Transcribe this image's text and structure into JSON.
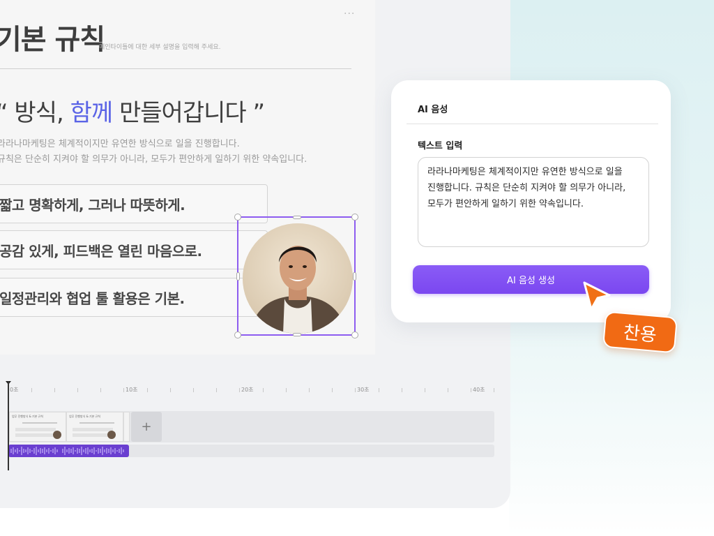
{
  "slide": {
    "more_icon": "···",
    "title": "기본 규칙",
    "title_desc": "메인타이틀에 대한 세부 설명을 입력해 주세요.",
    "quote_prefix": "“ 방식,",
    "quote_accent": " 함께",
    "quote_suffix": " 만들어갑니다 ”",
    "desc_line1": "라라나마케팅은 체계적이지만 유연한 방식으로 일을 진행합니다.",
    "desc_line2": "규칙은 단순히 지켜야 할 의무가 아니라, 모두가 편안하게 일하기 위한 약속입니다.",
    "rules": [
      "짧고 명확하게, 그러나 따뜻하게.",
      "공감 있게, 피드백은 열린 마음으로.",
      "일정관리와 협업 툴 활용은 기본."
    ]
  },
  "timeline": {
    "ruler_labels": [
      "0초",
      "10초",
      "20초",
      "30초",
      "40초"
    ],
    "add_clip_icon": "+",
    "clip_title": "업무 진행방식 & 기본 규칙"
  },
  "ai_panel": {
    "title": "AI 음성",
    "text_input_label": "텍스트 입력",
    "text_value": "라라나마케팅은 체계적이지만 유연한 방식으로 일을\n진행합니다. 규칙은 단순히 지켜야 할 의무가 아니라,\n모두가 편안하게 일하기 위한 약속입니다.",
    "generate_button": "AI 음성 생성"
  },
  "badge": {
    "label": "찬용"
  },
  "colors": {
    "accent_purple": "#7b47f0",
    "badge_orange": "#f16a14",
    "quote_accent": "#5b64e6"
  }
}
